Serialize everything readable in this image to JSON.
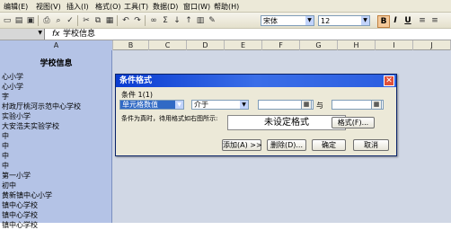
{
  "menu": [
    "编辑(E)",
    "视图(V)",
    "插入(I)",
    "格式(O)",
    "工具(T)",
    "数据(D)",
    "窗口(W)",
    "帮助(H)"
  ],
  "toolbar": {
    "font_name": "宋体",
    "font_size": "12"
  },
  "formula_bar": {
    "fx": "fx",
    "value": "学校信息"
  },
  "columns": [
    "A",
    "B",
    "C",
    "D",
    "E",
    "F",
    "G",
    "H",
    "I",
    "J"
  ],
  "sheet": {
    "title_cell": "学校信息",
    "column_a": [
      "心小学",
      "心小学",
      "字",
      "村政厅桃河示范中心学校",
      "实验小学",
      "大安浩夫实验学校",
      "中",
      "中",
      "中",
      "中",
      "第一小学",
      "初中",
      "黄新镇中心小学",
      "镇中心学校",
      "镇中心学校",
      "镇中心学校"
    ]
  },
  "dialog": {
    "title": "条件格式",
    "condition_label": "条件 1(1)",
    "condition_type": "单元格数值",
    "operator": "介于",
    "value1": "",
    "and_label": "与",
    "value2": "",
    "preview_caption": "条件为真时，待用格式如右图所示:",
    "preview_text": "未设定格式",
    "format_button": "格式(F)...",
    "add_button": "添加(A) >>",
    "delete_button": "删除(D)...",
    "ok_button": "确定",
    "cancel_button": "取消",
    "close_glyph": "✕"
  },
  "colors": {
    "title_bar": "#0a3cd1",
    "selected_column": "#b4c3e6",
    "dialog_bg": "#ece9d8"
  }
}
